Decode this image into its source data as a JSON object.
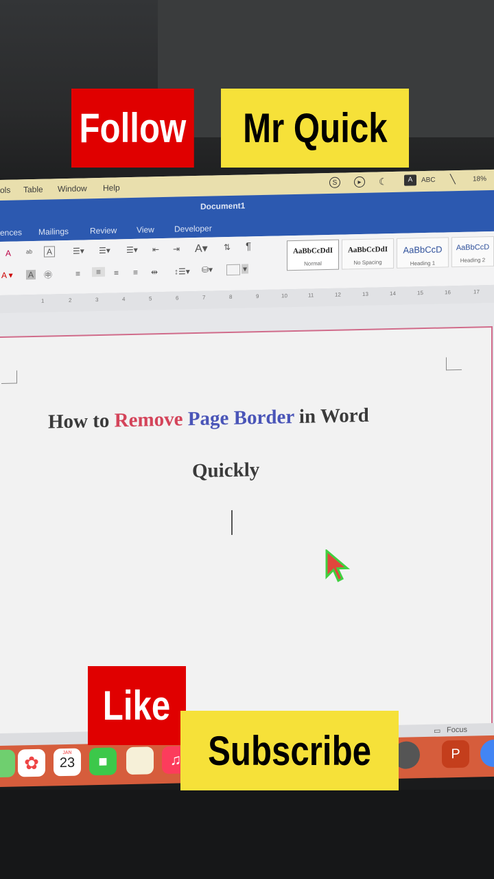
{
  "overlay": {
    "follow": "Follow",
    "channel": "Mr Quick",
    "like": "Like",
    "subscribe": "Subscribe"
  },
  "menubar": {
    "items": [
      "ols",
      "Table",
      "Window",
      "Help"
    ],
    "input_badge": "A",
    "input_label": "ABC",
    "battery": "18%"
  },
  "titlebar": {
    "doc_title": "Document1",
    "tabs": [
      "ences",
      "Mailings",
      "Review",
      "View",
      "Developer"
    ]
  },
  "styles": [
    {
      "sample": "AaBbCcDdI",
      "name": "Normal"
    },
    {
      "sample": "AaBbCcDdI",
      "name": "No Spacing"
    },
    {
      "sample": "AaBbCcD",
      "name": "Heading 1"
    },
    {
      "sample": "AaBbCcD",
      "name": "Heading 2"
    }
  ],
  "ruler": [
    "1",
    "2",
    "3",
    "4",
    "5",
    "6",
    "7",
    "8",
    "9",
    "10",
    "11",
    "12",
    "13",
    "14",
    "15",
    "16",
    "17"
  ],
  "document": {
    "line1_part1": "How to ",
    "line1_red": "Remove",
    "line1_blue": "Page Border",
    "line1_part2": " in Word",
    "line2": "Quickly"
  },
  "statusbar": {
    "focus": "Focus"
  },
  "dock": {
    "calendar_month": "JAN",
    "calendar_day": "23"
  },
  "colors": {
    "titlebar_blue": "#2c59b0",
    "page_border_pink": "#d06b8a",
    "banner_red": "#e00000",
    "banner_yellow": "#f6e139",
    "remove_red": "#d4445a",
    "border_blue": "#4a55b8"
  }
}
